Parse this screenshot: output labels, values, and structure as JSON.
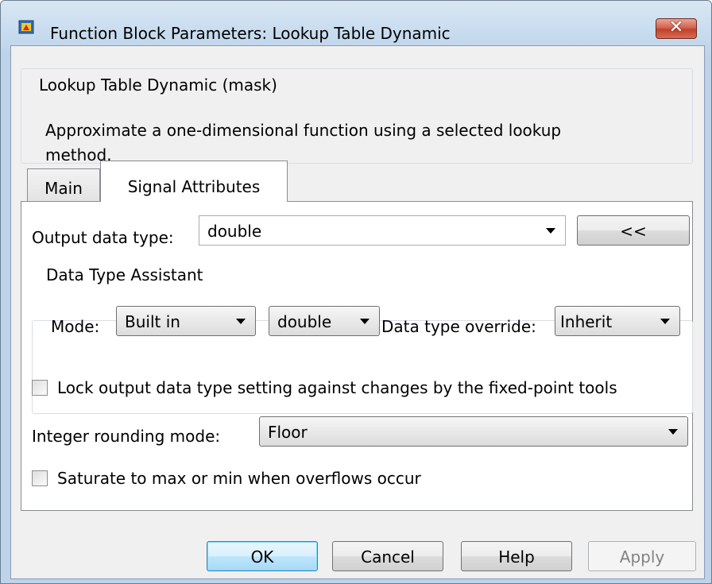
{
  "window": {
    "title": "Function Block Parameters: Lookup Table Dynamic",
    "close_label": "✕"
  },
  "description": {
    "legend": "Lookup Table Dynamic (mask)",
    "line1": "Approximate a one-dimensional function using a selected lookup",
    "line2": "method."
  },
  "tabs": [
    {
      "label": "Main",
      "active": false
    },
    {
      "label": "Signal Attributes",
      "active": true
    }
  ],
  "signal_attributes": {
    "output_data_type_label": "Output data type:",
    "output_data_type_value": "double",
    "toggle_assistant_label": "<<",
    "assistant": {
      "legend": "Data Type Assistant",
      "mode_label": "Mode:",
      "mode_value": "Built in",
      "type_value": "double",
      "override_label": "Data type override:",
      "override_value": "Inherit"
    },
    "lock_label": "Lock output data type setting against changes by the fixed-point tools",
    "lock_checked": false,
    "rounding_label": "Integer rounding mode:",
    "rounding_value": "Floor",
    "saturate_label": "Saturate to max or min when overflows occur",
    "saturate_checked": false
  },
  "buttons": {
    "ok": "OK",
    "cancel": "Cancel",
    "help": "Help",
    "apply": "Apply"
  }
}
